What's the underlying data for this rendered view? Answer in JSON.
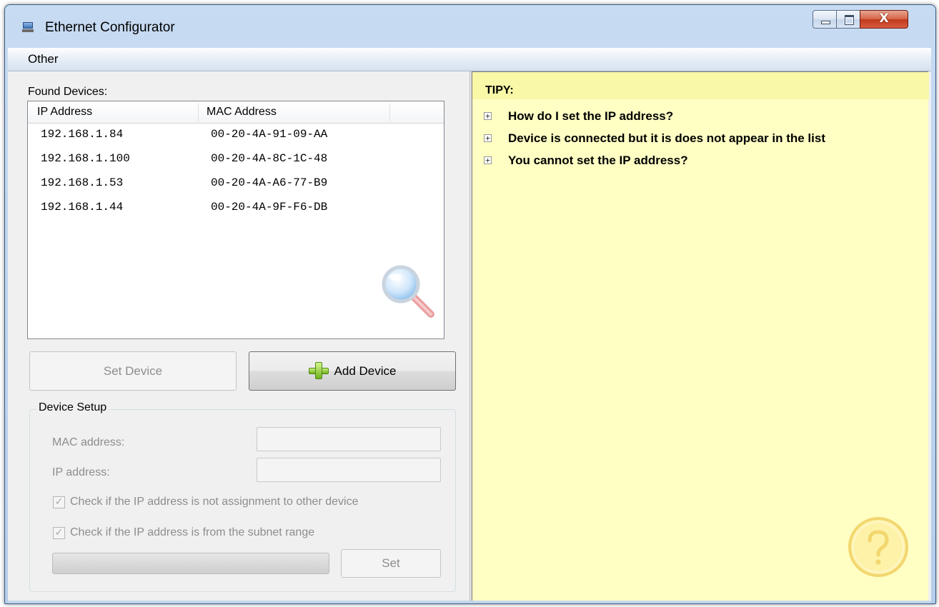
{
  "window": {
    "title": "Ethernet Configurator",
    "controls": {
      "close_glyph": "X"
    }
  },
  "menu": {
    "items": [
      "Other"
    ]
  },
  "devices": {
    "label": "Found Devices:",
    "columns": [
      "IP Address",
      "MAC Address"
    ],
    "rows": [
      {
        "ip": "192.168.1.84",
        "mac": "00-20-4A-91-09-AA"
      },
      {
        "ip": "192.168.1.100",
        "mac": "00-20-4A-8C-1C-48"
      },
      {
        "ip": "192.168.1.53",
        "mac": "00-20-4A-A6-77-B9"
      },
      {
        "ip": "192.168.1.44",
        "mac": "00-20-4A-9F-F6-DB"
      }
    ],
    "search_icon": "search-magnifier-icon"
  },
  "buttons": {
    "set_device": "Set Device",
    "add_device": "Add Device"
  },
  "device_setup": {
    "legend": "Device Setup",
    "mac_label": "MAC address:",
    "mac_value": "",
    "ip_label": "IP address:",
    "ip_value": "",
    "check_assignment": "Check if the IP address is not assignment to other device",
    "check_assignment_checked": true,
    "check_subnet": "Check if the IP address is from the subnet range",
    "check_subnet_checked": true,
    "progress": 0,
    "set_button": "Set"
  },
  "tips": {
    "title": "TIPY:",
    "items": [
      "How do I set the IP address?",
      "Device is connected but it is does not appear in the list",
      "You cannot set the IP address?"
    ],
    "expand_glyph": "+",
    "help_icon": "question-mark-icon"
  },
  "colors": {
    "tips_background": "#ffffc4",
    "tips_header": "#f8f8a7",
    "disabled_text": "#8d8d8d"
  }
}
